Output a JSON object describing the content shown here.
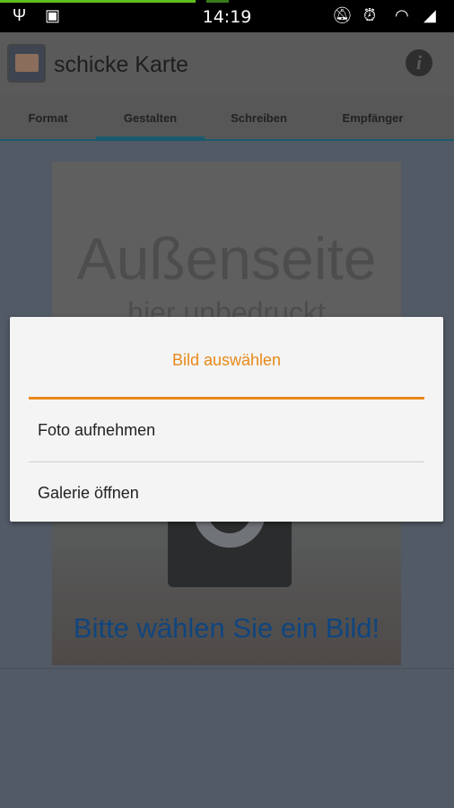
{
  "status_bar": {
    "time": "14:19",
    "icons": [
      "usb-icon",
      "android-debug-icon",
      "vibrate-icon",
      "alarm-icon",
      "wifi-icon",
      "signal-icon"
    ]
  },
  "app_bar": {
    "title": "schicke Karte",
    "info_icon": "info-icon"
  },
  "tabs": [
    {
      "label": "Format"
    },
    {
      "label": "Gestalten",
      "selected": true
    },
    {
      "label": "Schreiben"
    },
    {
      "label": "Empfänger"
    }
  ],
  "card": {
    "heading": "Außenseite",
    "subheading": "hier unbedruckt",
    "prompt": "Bitte wählen Sie ein Bild!"
  },
  "dialog": {
    "title": "Bild auswählen",
    "items": [
      {
        "label": "Foto aufnehmen"
      },
      {
        "label": "Galerie öffnen"
      }
    ]
  },
  "colors": {
    "accent": "#e8891a",
    "tab_indicator": "#1b5a6e",
    "prompt": "#10457e"
  }
}
